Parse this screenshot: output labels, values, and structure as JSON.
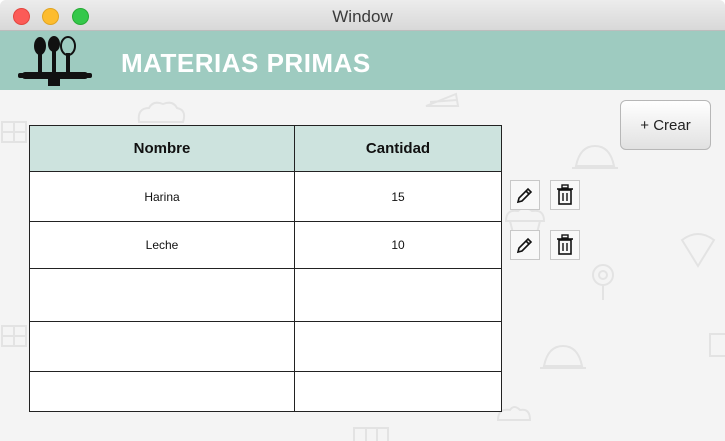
{
  "window": {
    "title": "Window"
  },
  "header": {
    "title": "MATERIAS PRIMAS",
    "logo_icon": "kitchen-utensils-icon",
    "background": "#9ecbc0"
  },
  "toolbar": {
    "create_label": "+ Crear"
  },
  "table": {
    "columns": [
      "Nombre",
      "Cantidad"
    ],
    "rows": [
      {
        "nombre": "Harina",
        "cantidad": "15"
      },
      {
        "nombre": "Leche",
        "cantidad": "10"
      }
    ],
    "empty_rows": 3
  },
  "row_actions": {
    "edit_icon": "pencil-icon",
    "delete_icon": "trash-icon"
  },
  "colors": {
    "header_bg": "#9ecbc0",
    "table_header_bg": "#cde3de",
    "accent": "#ffffff"
  }
}
